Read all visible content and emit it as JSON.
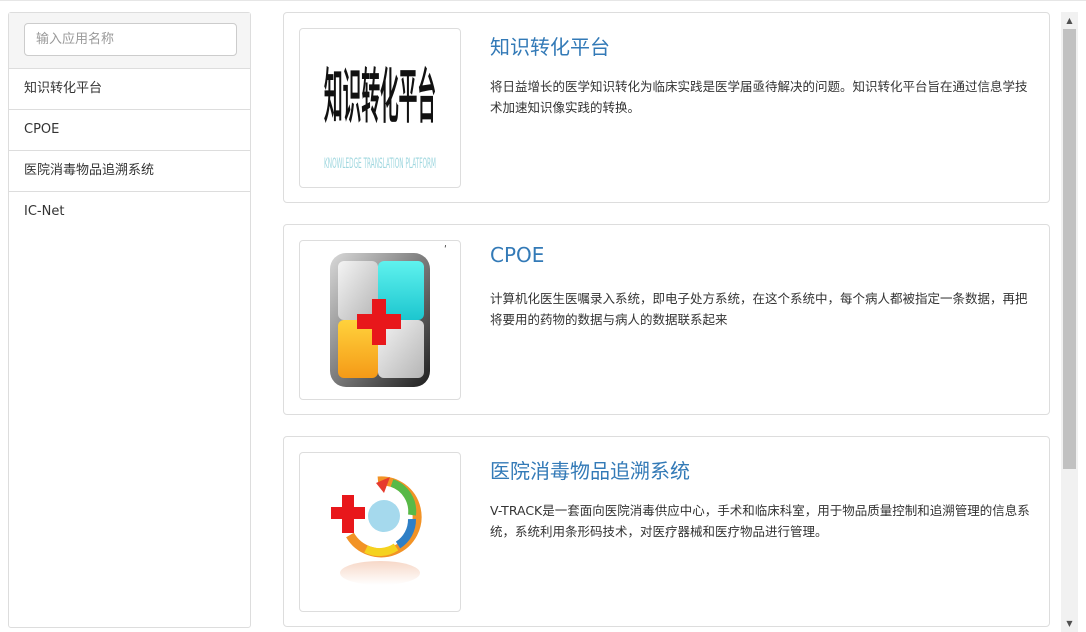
{
  "sidebar": {
    "search_placeholder": "输入应用名称",
    "items": [
      {
        "label": "知识转化平台"
      },
      {
        "label": "CPOE"
      },
      {
        "label": "医院消毒物品追溯系统"
      },
      {
        "label": "IC-Net"
      }
    ]
  },
  "apps": [
    {
      "title": "知识转化平台",
      "description": "将日益增长的医学知识转化为临床实践是医学届亟待解决的问题。知识转化平台旨在通过信息学技术加速知识像实践的转换。",
      "logo_text": "知识转化平台",
      "logo_subtext": "KNOWLEDGE TRANSLATION PLATFORM"
    },
    {
      "title": "CPOE",
      "description": "计算机化医生医嘱录入系统，即电子处方系统，在这个系统中，每个病人都被指定一条数据，再把将要用的药物的数据与病人的数据联系起来"
    },
    {
      "title": "医院消毒物品追溯系统",
      "description": "V-TRACK是一套面向医院消毒供应中心，手术和临床科室，用于物品质量控制和追溯管理的信息系统，系统利用条形码技术，对医疗器械和医疗物品进行管理。"
    }
  ],
  "icons": {
    "scroll_up": "scroll-up-arrow",
    "scroll_down": "scroll-down-arrow"
  },
  "colors": {
    "link": "#337ab7",
    "border": "#dddddd",
    "red_cross": "#e8171b"
  }
}
